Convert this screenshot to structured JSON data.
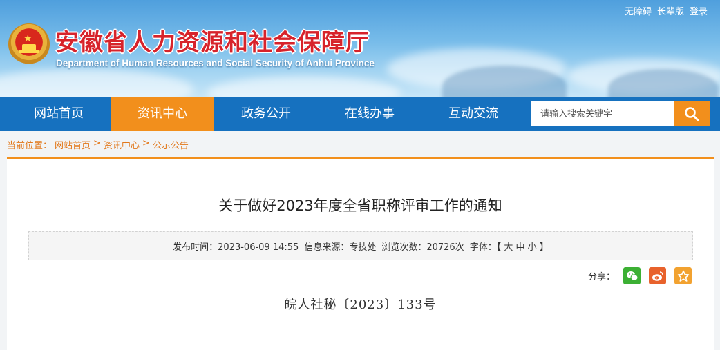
{
  "header": {
    "top_links": [
      "无障碍",
      "长辈版",
      "登录"
    ],
    "site_title": "安徽省人力资源和社会保障厅",
    "site_subtitle": "Department of Human Resources and Social Security of Anhui Province"
  },
  "nav": {
    "items": [
      {
        "label": "网站首页",
        "active": false
      },
      {
        "label": "资讯中心",
        "active": true
      },
      {
        "label": "政务公开",
        "active": false
      },
      {
        "label": "在线办事",
        "active": false
      },
      {
        "label": "互动交流",
        "active": false
      }
    ],
    "search_placeholder": "请输入搜索关键字",
    "accent_color": "#f28f1c",
    "nav_color": "#1671bf"
  },
  "breadcrumb": {
    "prefix": "当前位置：",
    "items": [
      "网站首页",
      "资讯中心",
      "公示公告"
    ],
    "separator": ">"
  },
  "article": {
    "title": "关于做好2023年度全省职称评审工作的通知",
    "meta": {
      "publish_time": "发布时间：2023-06-09 14:55",
      "source": "信息来源：专技处",
      "views": "浏览次数：20726次",
      "font_size_label": "字体：【",
      "font_large": "大",
      "font_medium": "中",
      "font_small": "小",
      "font_close": "】"
    },
    "share_label": "分享：",
    "share_icons": [
      "wechat-icon",
      "weibo-icon",
      "favorite-star-icon"
    ],
    "doc_number": "皖人社秘〔2023〕133号"
  }
}
